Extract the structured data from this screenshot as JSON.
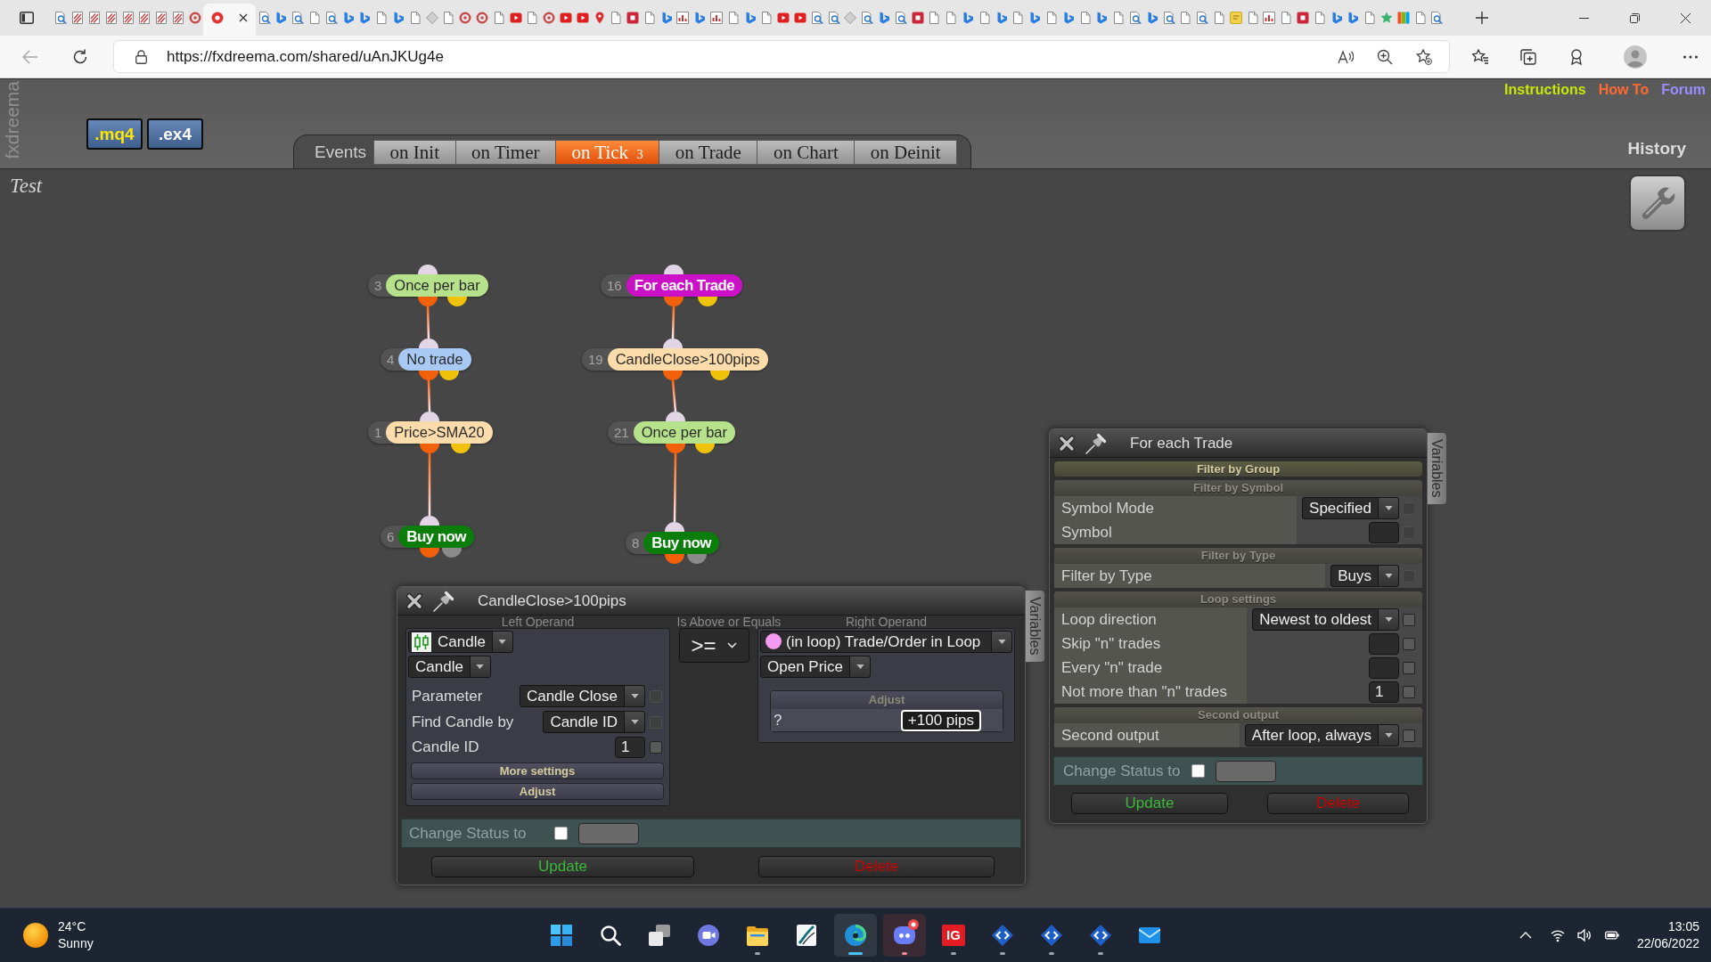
{
  "browser": {
    "tabs": [
      {
        "kind": "search",
        "selected": false
      },
      {
        "kind": "slash",
        "selected": false
      },
      {
        "kind": "slash",
        "selected": false
      },
      {
        "kind": "slash",
        "selected": false
      },
      {
        "kind": "slash",
        "selected": false
      },
      {
        "kind": "slash",
        "selected": false
      },
      {
        "kind": "slash",
        "selected": false
      },
      {
        "kind": "slash",
        "selected": false
      },
      {
        "kind": "swirl",
        "selected": false
      },
      {
        "kind": "app",
        "selected": true
      },
      {
        "kind": "search",
        "selected": false
      },
      {
        "kind": "bing",
        "selected": false
      },
      {
        "kind": "search",
        "selected": false
      },
      {
        "kind": "doc",
        "selected": false
      },
      {
        "kind": "search",
        "selected": false
      },
      {
        "kind": "bing",
        "selected": false
      },
      {
        "kind": "bing",
        "selected": false
      },
      {
        "kind": "doc",
        "selected": false
      },
      {
        "kind": "bing",
        "selected": false
      },
      {
        "kind": "doc",
        "selected": false
      },
      {
        "kind": "diamond",
        "selected": false
      },
      {
        "kind": "doc",
        "selected": false
      },
      {
        "kind": "swirl",
        "selected": false
      },
      {
        "kind": "swirl",
        "selected": false
      },
      {
        "kind": "doc",
        "selected": false
      },
      {
        "kind": "video",
        "selected": false
      },
      {
        "kind": "doc",
        "selected": false
      },
      {
        "kind": "swirl",
        "selected": false
      },
      {
        "kind": "video",
        "selected": false
      },
      {
        "kind": "video",
        "selected": false
      },
      {
        "kind": "pin",
        "selected": false
      },
      {
        "kind": "doc",
        "selected": false
      },
      {
        "kind": "letter",
        "selected": false
      },
      {
        "kind": "doc",
        "selected": false
      },
      {
        "kind": "bing",
        "selected": false
      },
      {
        "kind": "chart",
        "selected": false
      },
      {
        "kind": "bing",
        "selected": false
      },
      {
        "kind": "chart",
        "selected": false
      },
      {
        "kind": "doc",
        "selected": false
      },
      {
        "kind": "bing",
        "selected": false
      },
      {
        "kind": "doc",
        "selected": false
      },
      {
        "kind": "video",
        "selected": false
      },
      {
        "kind": "video",
        "selected": false
      },
      {
        "kind": "search",
        "selected": false
      },
      {
        "kind": "search",
        "selected": false
      },
      {
        "kind": "diamond",
        "selected": false
      },
      {
        "kind": "search",
        "selected": false
      },
      {
        "kind": "bing",
        "selected": false
      },
      {
        "kind": "search",
        "selected": false
      },
      {
        "kind": "letter",
        "selected": false
      },
      {
        "kind": "doc",
        "selected": false
      },
      {
        "kind": "doc",
        "selected": false
      },
      {
        "kind": "bing",
        "selected": false
      },
      {
        "kind": "doc",
        "selected": false
      },
      {
        "kind": "bing",
        "selected": false
      },
      {
        "kind": "doc",
        "selected": false
      },
      {
        "kind": "bing",
        "selected": false
      },
      {
        "kind": "doc",
        "selected": false
      },
      {
        "kind": "bing",
        "selected": false
      },
      {
        "kind": "doc",
        "selected": false
      },
      {
        "kind": "bing",
        "selected": false
      },
      {
        "kind": "doc",
        "selected": false
      },
      {
        "kind": "search",
        "selected": false
      },
      {
        "kind": "bing",
        "selected": false
      },
      {
        "kind": "search",
        "selected": false
      },
      {
        "kind": "doc",
        "selected": false
      },
      {
        "kind": "search",
        "selected": false
      },
      {
        "kind": "doc",
        "selected": false
      },
      {
        "kind": "note",
        "selected": false
      },
      {
        "kind": "doc",
        "selected": false
      },
      {
        "kind": "chart",
        "selected": false
      },
      {
        "kind": "doc",
        "selected": false
      },
      {
        "kind": "letter",
        "selected": false
      },
      {
        "kind": "doc",
        "selected": false
      },
      {
        "kind": "bing",
        "selected": false
      },
      {
        "kind": "bing",
        "selected": false
      },
      {
        "kind": "doc",
        "selected": false
      },
      {
        "kind": "star",
        "selected": false
      },
      {
        "kind": "photo",
        "selected": false
      },
      {
        "kind": "doc",
        "selected": false
      },
      {
        "kind": "search",
        "selected": false
      }
    ],
    "address": {
      "url": "https://fxdreema.com/shared/uAnJKUg4e"
    }
  },
  "header": {
    "side_label": "fxdreema",
    "export_buttons": [
      ".mq4",
      ".ex4"
    ],
    "links": [
      {
        "label": "Instructions",
        "color": "#c8e60a"
      },
      {
        "label": "How To",
        "color": "#ff6a30"
      },
      {
        "label": "Forum",
        "color": "#9d8cff"
      }
    ],
    "events_label": "Events",
    "event_tabs": [
      {
        "label": "on Init",
        "selected": false
      },
      {
        "label": "on Timer",
        "selected": false
      },
      {
        "label": "on Tick",
        "count": "3",
        "selected": true
      },
      {
        "label": "on Trade",
        "selected": false
      },
      {
        "label": "on Chart",
        "selected": false
      },
      {
        "label": "on Deinit",
        "selected": false
      }
    ],
    "history": "History"
  },
  "project_name": "Test",
  "canvas": {
    "columns": [
      {
        "blocks": [
          {
            "number": "3",
            "label": "Once per bar",
            "kind": "condition",
            "color": "#b6e28c"
          },
          {
            "number": "4",
            "label": "No trade",
            "kind": "condition",
            "color": "#a9c9f5"
          },
          {
            "number": "1",
            "label": "Price>SMA20",
            "kind": "condition",
            "color": "#fddcab"
          },
          {
            "number": "6",
            "label": "Buy now",
            "kind": "action",
            "color": "#0a7d0a"
          }
        ]
      },
      {
        "blocks": [
          {
            "number": "16",
            "label": "For each Trade",
            "kind": "loop",
            "color": "#cc10c8"
          },
          {
            "number": "19",
            "label": "CandleClose>100pips",
            "kind": "condition",
            "color": "#fddcab"
          },
          {
            "number": "21",
            "label": "Once per bar",
            "kind": "condition",
            "color": "#b6e28c"
          },
          {
            "number": "8",
            "label": "Buy now",
            "kind": "action",
            "color": "#0a7d0a"
          }
        ]
      }
    ]
  },
  "condition_dialog": {
    "title": "CandleClose>100pips",
    "side_tab": "Variables",
    "left_operand": {
      "heading": "Left Operand",
      "source": "Candle",
      "subtype": "Candle",
      "params": [
        {
          "label": "Parameter",
          "kind": "select",
          "value": "Candle Close",
          "checkbox_enabled": false
        },
        {
          "label": "Find Candle by",
          "kind": "select",
          "value": "Candle ID",
          "checkbox_enabled": false
        },
        {
          "label": "Candle ID",
          "kind": "input",
          "value": "1",
          "checkbox_enabled": true
        }
      ],
      "sections": [
        "More settings",
        "Adjust"
      ]
    },
    "operator": {
      "heading": "Is Above or Equals",
      "value": ">="
    },
    "right_operand": {
      "heading": "Right Operand",
      "source": "(in loop) Trade/Order in Loop",
      "subtype": "Open Price",
      "adjust": {
        "heading": "Adjust",
        "label": "?",
        "value": "+100 pips",
        "focused": true
      }
    },
    "status": {
      "label": "Change Status to",
      "checked": false
    },
    "buttons": [
      {
        "label": "Update",
        "kind": "update"
      },
      {
        "label": "Delete",
        "kind": "delete"
      }
    ]
  },
  "loop_dialog": {
    "title": "For each Trade",
    "side_tab": "Variables",
    "groups": [
      {
        "heading": "Filter by Group",
        "expanded": false
      },
      {
        "heading": "Filter by Symbol",
        "expanded": true,
        "rows": [
          {
            "label": "Symbol Mode",
            "kind": "select",
            "value": "Specified",
            "checkbox_enabled": false
          },
          {
            "label": "Symbol",
            "kind": "input",
            "checkbox_enabled": false
          }
        ]
      },
      {
        "heading": "Filter by Type",
        "expanded": true,
        "rows": [
          {
            "label": "Filter by Type",
            "kind": "select",
            "value": "Buys",
            "checkbox_enabled": false
          }
        ]
      },
      {
        "heading": "Loop settings",
        "expanded": true,
        "rows": [
          {
            "label": "Loop direction",
            "kind": "select",
            "value": "Newest to oldest",
            "checkbox_enabled": true
          },
          {
            "label": "Skip \"n\" trades",
            "kind": "input",
            "checkbox_enabled": true
          },
          {
            "label": "Every \"n\" trade",
            "kind": "input",
            "checkbox_enabled": true
          },
          {
            "label": "Not more than \"n\" trades",
            "kind": "input",
            "value": "1",
            "checkbox_enabled": true
          }
        ]
      },
      {
        "heading": "Second output",
        "expanded": true,
        "rows": [
          {
            "label": "Second output",
            "kind": "select",
            "value": "After loop, always",
            "checkbox_enabled": true
          }
        ]
      }
    ],
    "status": {
      "label": "Change Status to",
      "checked": false
    },
    "buttons": [
      {
        "label": "Update",
        "kind": "update"
      },
      {
        "label": "Delete",
        "kind": "delete"
      }
    ]
  },
  "taskbar": {
    "weather": {
      "temperature": "24°C",
      "condition": "Sunny"
    },
    "apps": [
      {
        "kind": "start",
        "running": false,
        "selected": false,
        "badge": false,
        "flashing": false
      },
      {
        "kind": "search",
        "running": false,
        "selected": false,
        "badge": false,
        "flashing": false
      },
      {
        "kind": "task_view",
        "running": false,
        "selected": false,
        "badge": false,
        "flashing": false
      },
      {
        "kind": "chat",
        "running": false,
        "selected": false,
        "badge": false,
        "flashing": false
      },
      {
        "kind": "explorer",
        "running": true,
        "selected": false,
        "badge": false,
        "flashing": false
      },
      {
        "kind": "notes",
        "running": false,
        "selected": false,
        "badge": false,
        "flashing": false
      },
      {
        "kind": "edge",
        "running": true,
        "selected": true,
        "badge": false,
        "flashing": false
      },
      {
        "kind": "discord",
        "running": true,
        "selected": false,
        "badge": true,
        "flashing": true
      },
      {
        "kind": "ig",
        "label": "IG",
        "running": true,
        "selected": false,
        "badge": false,
        "flashing": false
      },
      {
        "kind": "editor",
        "running": true,
        "selected": false,
        "badge": false,
        "flashing": false
      },
      {
        "kind": "editor",
        "running": true,
        "selected": false,
        "badge": false,
        "flashing": false
      },
      {
        "kind": "editor",
        "running": true,
        "selected": false,
        "badge": false,
        "flashing": false
      },
      {
        "kind": "mail",
        "running": false,
        "selected": false,
        "badge": false,
        "flashing": false
      }
    ],
    "clock": {
      "time": "13:05",
      "date": "22/06/2022"
    }
  }
}
